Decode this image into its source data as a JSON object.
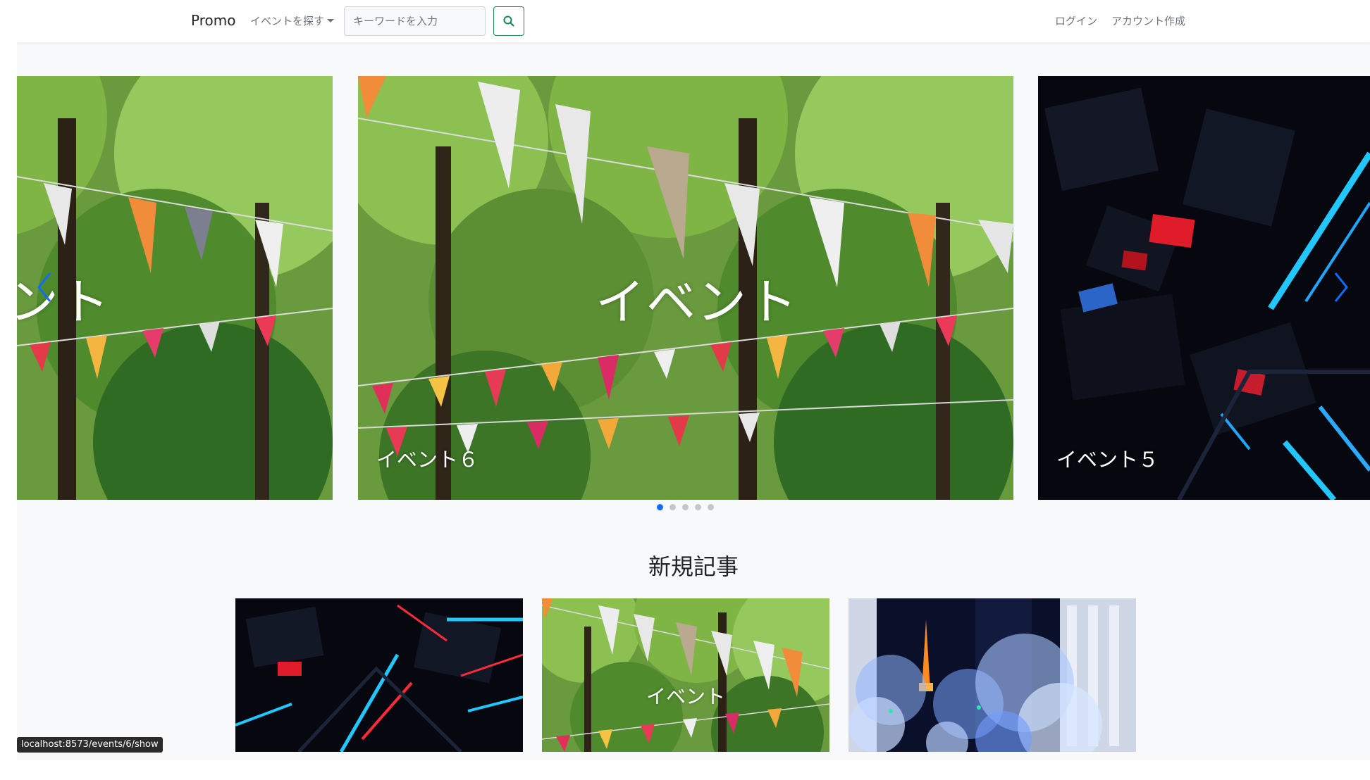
{
  "navbar": {
    "brand": "Promo",
    "explore_label": "イベントを探す",
    "search_placeholder": "キーワードを入力",
    "login_label": "ログイン",
    "signup_label": "アカウント作成"
  },
  "carousel": {
    "slides": [
      {
        "overlay_text": "イベント",
        "caption": "",
        "theme": "bunting"
      },
      {
        "overlay_text": "イベント",
        "caption": "イベント６",
        "theme": "bunting"
      },
      {
        "overlay_text": "",
        "caption": "イベント５",
        "theme": "neon"
      }
    ],
    "active_index": 0,
    "dot_count": 5
  },
  "new_articles": {
    "title": "新規記事",
    "cards": [
      {
        "overlay_text": "",
        "theme": "neon"
      },
      {
        "overlay_text": "イベント",
        "theme": "bunting"
      },
      {
        "overlay_text": "",
        "theme": "illumination"
      }
    ]
  },
  "status_bar": {
    "url": "localhost:8573/events/6/show"
  },
  "colors": {
    "accent_blue": "#0d6efd",
    "search_green": "#198754",
    "page_background": "#f8f9fa"
  },
  "icons": {
    "search": "magnifier-icon",
    "prev": "chevron-left-icon",
    "next": "chevron-right-icon"
  }
}
